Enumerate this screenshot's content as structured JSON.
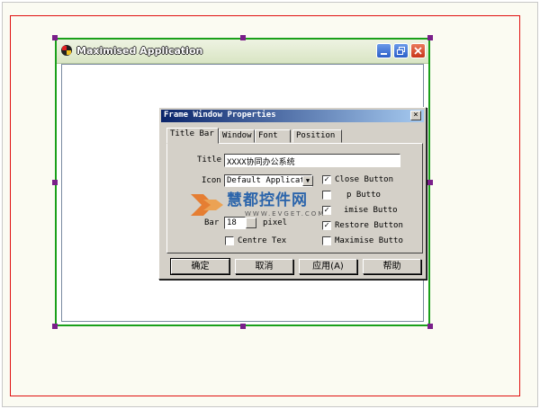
{
  "app_window": {
    "title": "Maximised Application"
  },
  "dialog": {
    "title": "Frame Window Properties",
    "close_glyph": "×",
    "tabs": [
      {
        "label": "Title Bar",
        "active": true
      },
      {
        "label": "Window",
        "active": false
      },
      {
        "label": "Font",
        "active": false
      },
      {
        "label": "Position",
        "active": false
      }
    ],
    "title_bar_tab": {
      "title_label": "Title",
      "title_value": "XXXX协同办公系统",
      "icon_label": "Icon",
      "icon_value": "Default Applicat",
      "bar_label": "Bar",
      "bar_value": "18",
      "pixels_label": "pixel",
      "centre_text_label": "Centre Tex",
      "centre_text_checked": false,
      "checkboxes": [
        {
          "label": "Close Button",
          "checked": true
        },
        {
          "label": "p Butto",
          "checked": false
        },
        {
          "label": "imise Butto",
          "checked": true
        },
        {
          "label": "Restore Button",
          "checked": true
        },
        {
          "label": "Maximise Butto",
          "checked": false
        }
      ]
    },
    "buttons": {
      "ok": "确定",
      "cancel": "取消",
      "apply": "应用(A)",
      "help": "帮助"
    }
  },
  "watermark": {
    "main": "慧都控件网",
    "sub": "WWW.EVGET.COM"
  },
  "colors": {
    "selection_border": "#1aa01a",
    "outer_frame": "#e01010",
    "handle": "#7a1f8a",
    "dialog_title_start": "#0a246a",
    "dialog_title_end": "#a6caf0",
    "dialog_face": "#d4d0c8"
  }
}
